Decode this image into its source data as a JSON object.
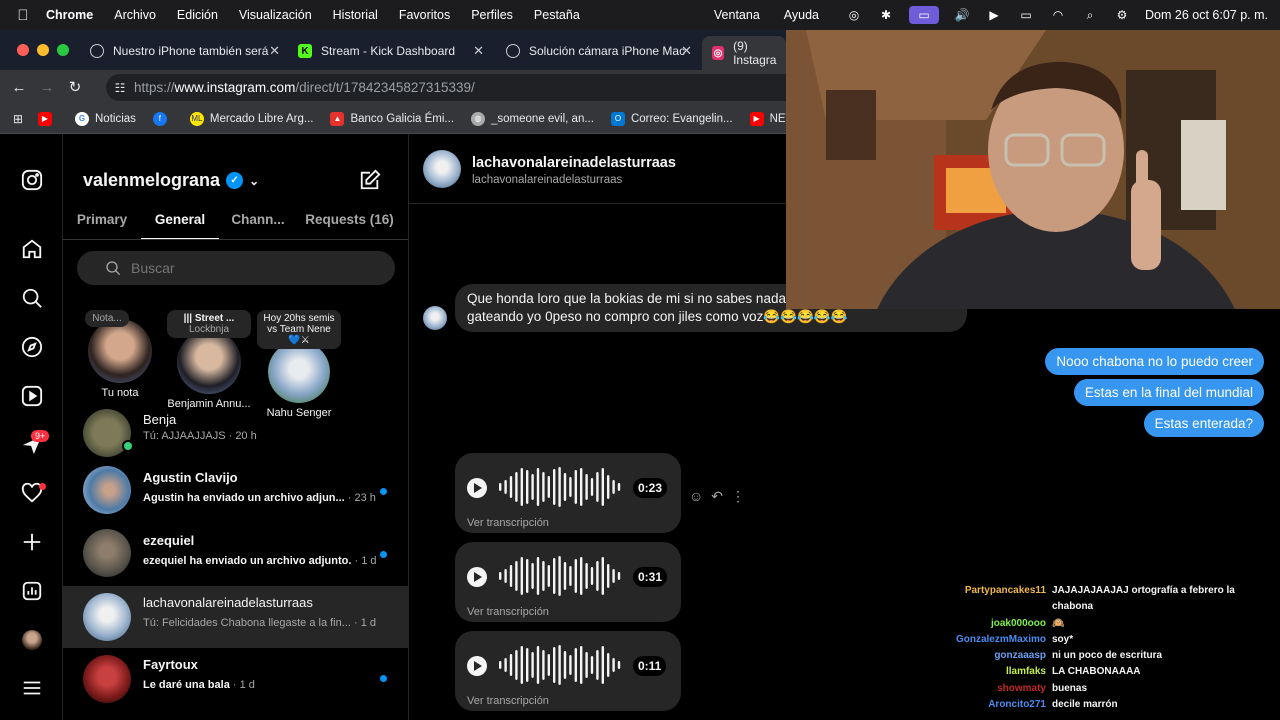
{
  "menubar": {
    "app": "Chrome",
    "items": [
      "Archivo",
      "Edición",
      "Visualización",
      "Historial",
      "Favoritos",
      "Perfiles",
      "Pestaña"
    ],
    "right_items": [
      "Ventana",
      "Ayuda"
    ],
    "datetime": "Dom 26 oct  6:07 p. m."
  },
  "tabs": [
    {
      "title": "Nuestro iPhone también será",
      "icon": "instagram-icon"
    },
    {
      "title": "Stream - Kick Dashboard",
      "icon": "kick-icon"
    },
    {
      "title": "Solución cámara iPhone Mac",
      "icon": "openai-icon"
    },
    {
      "title": "(9) Instagra",
      "icon": "instagram-icon"
    }
  ],
  "address": {
    "scheme": "https://",
    "host": "www.instagram.com",
    "path": "/direct/t/17842345827315339/"
  },
  "bookmarks": [
    "Noticias",
    "Mercado Libre Arg...",
    "Banco Galicia Émi...",
    "_someone evil, an...",
    "Correo: Evangelin...",
    "NET_GRA"
  ],
  "sidebar": {
    "username": "valenmelograna",
    "tabs": [
      "Primary",
      "General",
      "Chann...",
      "Requests (16)"
    ],
    "search_placeholder": "Buscar",
    "notes": [
      {
        "bubble": "Nota...",
        "name": "Tu nota"
      },
      {
        "bubble": "Street ...",
        "bubble_sub": "Lockbnja",
        "name": "Benjamin Annu..."
      },
      {
        "bubble": "Hoy 20hs semis vs Team Nene💙⚔",
        "name": "Nahu Senger"
      }
    ],
    "threads": [
      {
        "name": "Benja",
        "preview": "Tú: AJJAAJJAJS",
        "time": "· 20 h",
        "unread": false
      },
      {
        "name": "Agustin Clavijo",
        "preview": "Agustin ha enviado un archivo adjun...",
        "time": "· 23 h",
        "unread": true
      },
      {
        "name": "ezequiel",
        "preview": "ezequiel ha enviado un archivo adjunto.",
        "time": "· 1 d",
        "unread": true
      },
      {
        "name": "lachavonalareinadelasturraas",
        "preview": "Tú: Felicidades Chabona llegaste a la fin...",
        "time": "· 1 d",
        "unread": false
      },
      {
        "name": "Fayrtoux",
        "preview": "Le daré una bala",
        "time": "· 1 d",
        "unread": true
      }
    ],
    "rail_badge": "9+"
  },
  "chat": {
    "name": "lachavonalareinadelasturraas",
    "username": "lachavonalareinadelasturraas",
    "incoming_text": "Que honda loro que la bokias  de mi si no sabes nada de mi vida gato y seguí gateando yo 0peso no compro con jiles como voz😂😂😂😂😂",
    "outgoing": [
      "Nooo chabona no lo puedo creer",
      "Estas en la final del mundial",
      "Estas enterada?"
    ],
    "voice_notes": [
      {
        "duration": "0:23",
        "transcript": "Ver transcripción"
      },
      {
        "duration": "0:31",
        "transcript": "Ver transcripción"
      },
      {
        "duration": "0:11",
        "transcript": "Ver transcripción"
      }
    ]
  },
  "stream_chat": [
    {
      "user": "Partypancakes11",
      "color": "#f0b74a",
      "msg": "JAJAJAJAAJAJ ortografía a febrero la chabona"
    },
    {
      "user": "joak000ooo",
      "color": "#7cf04a",
      "msg": "🙉"
    },
    {
      "user": "GonzalezmMaximo",
      "color": "#4a8cf0",
      "msg": "soy*"
    },
    {
      "user": "gonzaaasp",
      "color": "#6aa0f0",
      "msg": "ni un poco de escritura"
    },
    {
      "user": "llamfaks",
      "color": "#c7f04a",
      "msg": "LA CHABONAAAA"
    },
    {
      "user": "showmaty",
      "color": "#c02828",
      "msg": "buenas"
    },
    {
      "user": "Aroncito271",
      "color": "#4a8cf0",
      "msg": "decile marrón"
    }
  ]
}
